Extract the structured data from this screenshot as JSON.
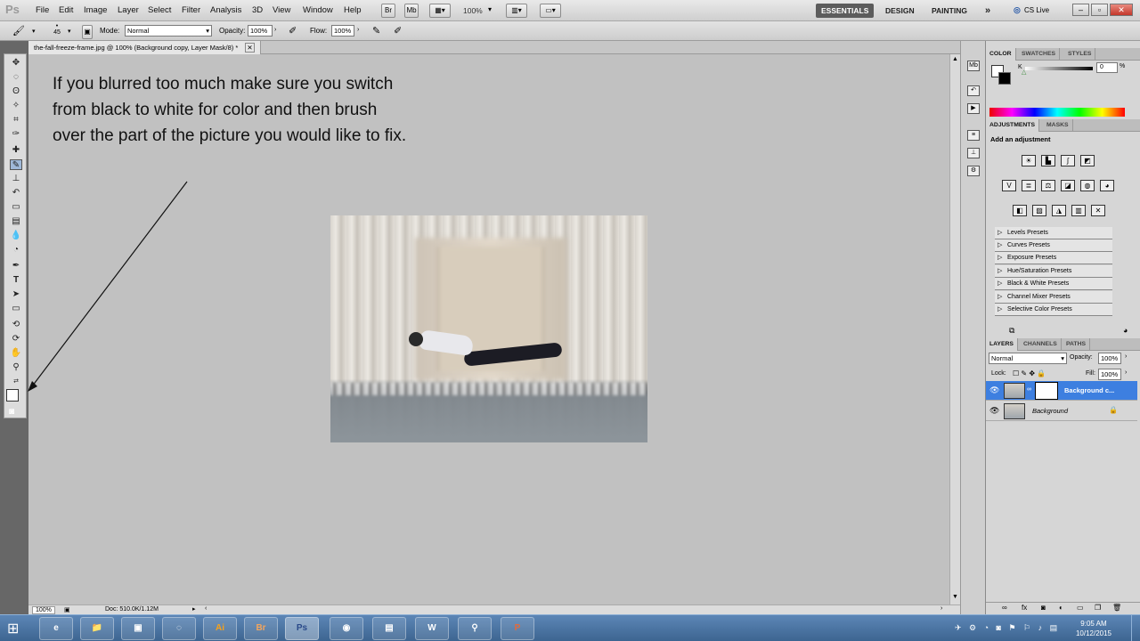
{
  "app": {
    "logo": "Ps"
  },
  "menu": [
    "File",
    "Edit",
    "Image",
    "Layer",
    "Select",
    "Filter",
    "Analysis",
    "3D",
    "View",
    "Window",
    "Help"
  ],
  "top_controls": {
    "zoom": "100%",
    "br": "Br",
    "mb": "Mb"
  },
  "workspaces": [
    "ESSENTIALS",
    "DESIGN",
    "PAINTING"
  ],
  "workspace_more": "»",
  "cs_live": "CS Live",
  "options": {
    "brush_size": "45",
    "mode_label": "Mode:",
    "mode_value": "Normal",
    "opacity_label": "Opacity:",
    "opacity_value": "100%",
    "flow_label": "Flow:",
    "flow_value": "100%"
  },
  "document": {
    "tab_title": "the-fall-freeze-frame.jpg @ 100% (Background copy, Layer Mask/8) *",
    "zoom": "100%",
    "doc_info": "Doc: 510.0K/1.12M"
  },
  "note": "If you blurred too much make sure you switch from black to white for color and then brush over the part of the picture you would like to fix.",
  "panels": {
    "color_tabs": [
      "COLOR",
      "SWATCHES",
      "STYLES"
    ],
    "color_channel": "K",
    "color_value": "0",
    "color_unit": "%",
    "adj_tabs": [
      "ADJUSTMENTS",
      "MASKS"
    ],
    "adj_heading": "Add an adjustment",
    "presets": [
      "Levels Presets",
      "Curves Presets",
      "Exposure Presets",
      "Hue/Saturation Presets",
      "Black & White Presets",
      "Channel Mixer Presets",
      "Selective Color Presets"
    ],
    "layers_tabs": [
      "LAYERS",
      "CHANNELS",
      "PATHS"
    ],
    "blend_mode": "Normal",
    "opacity_label": "Opacity:",
    "opacity_value": "100%",
    "lock_label": "Lock:",
    "fill_label": "Fill:",
    "fill_value": "100%",
    "layers": [
      {
        "name": "Background c...",
        "selected": true
      },
      {
        "name": "Background",
        "selected": false
      }
    ]
  },
  "taskbar": {
    "apps": [
      "e",
      "📁",
      "▣",
      "◌",
      "Ai",
      "Br",
      "Ps",
      "◉",
      "▤",
      "W",
      "⚲",
      "P"
    ],
    "time": "9:05 AM",
    "date": "10/12/2015"
  }
}
